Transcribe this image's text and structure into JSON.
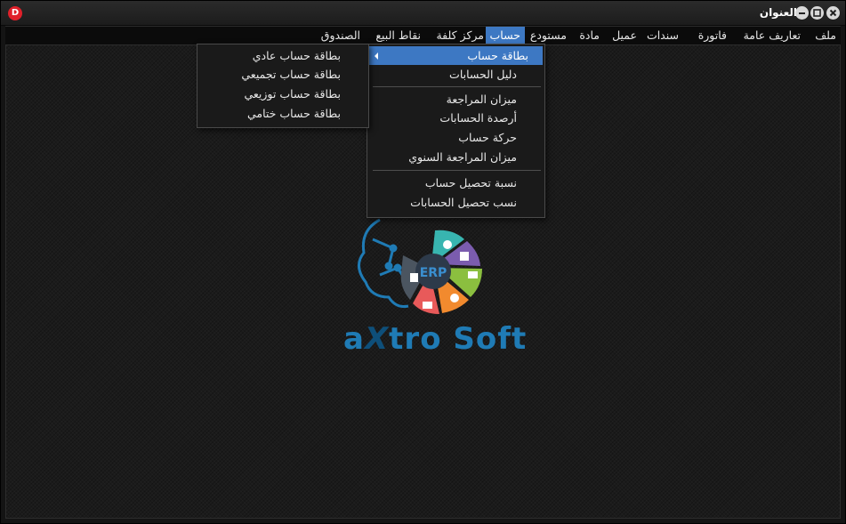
{
  "window": {
    "title": "العنوان",
    "app_icon_letter": "D"
  },
  "menubar": {
    "items": [
      "ملف",
      "تعاريف عامة",
      "فاتورة",
      "سندات",
      "عميل",
      "مادة",
      "مستودع",
      "حساب",
      "مركز كلفة",
      "نقاط البيع",
      "الصندوق"
    ],
    "active": "حساب"
  },
  "account_menu": {
    "group1": [
      "بطاقة حساب",
      "دليل الحسابات"
    ],
    "group2": [
      "ميزان المراجعة",
      "أرصدة الحسابات",
      "حركة حساب",
      "ميزان المراجعة السنوي"
    ],
    "group3": [
      "نسبة تحصيل حساب",
      "نسب تحصيل الحسابات"
    ],
    "highlighted": "بطاقة حساب"
  },
  "account_card_submenu": {
    "items": [
      "بطاقة حساب عادي",
      "بطاقة حساب تجميعي",
      "بطاقة حساب توزيعي",
      "بطاقة حساب ختامي"
    ]
  },
  "logo": {
    "center_text": "ERP",
    "brand_a": "a",
    "brand_x": "X",
    "brand_rest": "tro Soft"
  },
  "colors": {
    "accent": "#3d78c3",
    "brand": "#1f7bb5"
  }
}
